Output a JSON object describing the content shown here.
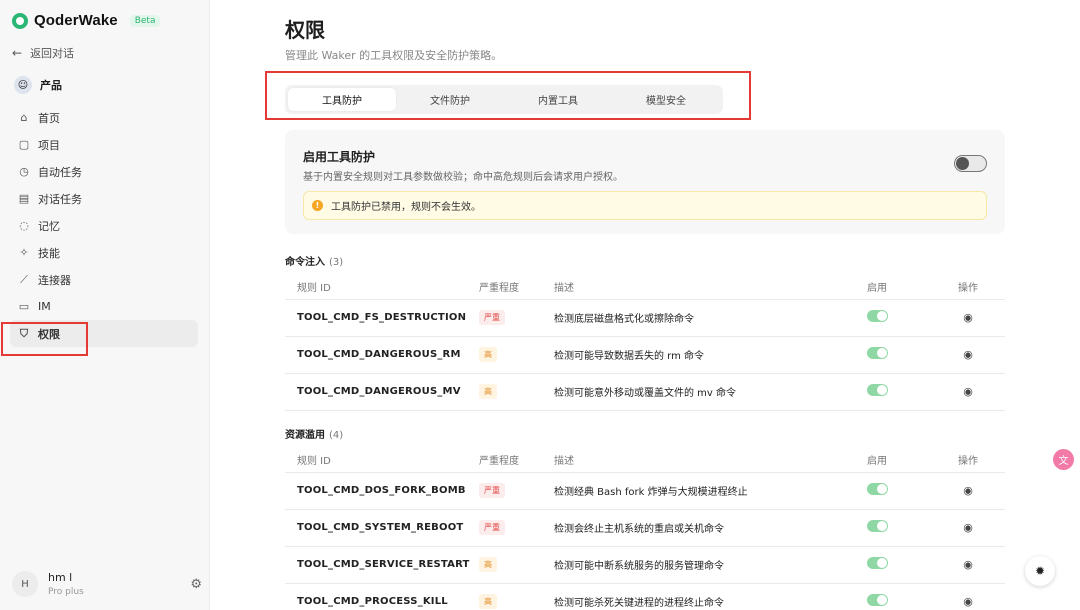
{
  "sidebar": {
    "brand": "QoderWake",
    "beta": "Beta",
    "back": "返回对话",
    "workspace": "产品",
    "items": [
      {
        "label": "首页",
        "icon": "home-icon",
        "glyph": "⌂"
      },
      {
        "label": "项目",
        "icon": "folder-icon",
        "glyph": "▢"
      },
      {
        "label": "自动任务",
        "icon": "clock-icon",
        "glyph": "◷"
      },
      {
        "label": "对话任务",
        "icon": "calendar-icon",
        "glyph": "▤"
      },
      {
        "label": "记忆",
        "icon": "memory-icon",
        "glyph": "◌"
      },
      {
        "label": "技能",
        "icon": "bolt-icon",
        "glyph": "✧"
      },
      {
        "label": "连接器",
        "icon": "plug-icon",
        "glyph": "⟋"
      },
      {
        "label": "IM",
        "icon": "message-icon",
        "glyph": "▭"
      },
      {
        "label": "权限",
        "icon": "shield-icon",
        "glyph": "⛉",
        "active": true
      }
    ],
    "user": {
      "initial": "H",
      "name": "hm l",
      "plan": "Pro plus"
    }
  },
  "page": {
    "title": "权限",
    "subtitle": "管理此 Waker 的工具权限及安全防护策略。",
    "tabs": [
      "工具防护",
      "文件防护",
      "内置工具",
      "模型安全"
    ],
    "active_tab": 0
  },
  "protection": {
    "title": "启用工具防护",
    "desc": "基于内置安全规则对工具参数做校验；命中高危规则后会请求用户授权。",
    "enabled": false,
    "warning": "工具防护已禁用，规则不会生效。"
  },
  "table_headers": {
    "id": "规则 ID",
    "severity": "严重程度",
    "desc": "描述",
    "enabled": "启用",
    "op": "操作"
  },
  "sections": [
    {
      "title": "命令注入",
      "count": "(3)",
      "rules": [
        {
          "id": "TOOL_CMD_FS_DESTRUCTION",
          "severity": "严重",
          "level": "crit",
          "desc": "检测底层磁盘格式化或擦除命令",
          "enabled": true
        },
        {
          "id": "TOOL_CMD_DANGEROUS_RM",
          "severity": "高",
          "level": "high",
          "desc": "检测可能导致数据丢失的 rm 命令",
          "enabled": true
        },
        {
          "id": "TOOL_CMD_DANGEROUS_MV",
          "severity": "高",
          "level": "high",
          "desc": "检测可能意外移动或覆盖文件的 mv 命令",
          "enabled": true
        }
      ]
    },
    {
      "title": "资源滥用",
      "count": "(4)",
      "rules": [
        {
          "id": "TOOL_CMD_DOS_FORK_BOMB",
          "severity": "严重",
          "level": "crit",
          "desc": "检测经典 Bash fork 炸弹与大规模进程终止",
          "enabled": true
        },
        {
          "id": "TOOL_CMD_SYSTEM_REBOOT",
          "severity": "严重",
          "level": "crit",
          "desc": "检测会终止主机系统的重启或关机命令",
          "enabled": true
        },
        {
          "id": "TOOL_CMD_SERVICE_RESTART",
          "severity": "高",
          "level": "high",
          "desc": "检测可能中断系统服务的服务管理命令",
          "enabled": true
        },
        {
          "id": "TOOL_CMD_PROCESS_KILL",
          "severity": "高",
          "level": "high",
          "desc": "检测可能杀死关键进程的进程终止命令",
          "enabled": true
        }
      ]
    }
  ],
  "colors": {
    "brand": "#2bb673",
    "critical": "#e04343",
    "high": "#e08a1e",
    "toggle_on": "#8fd8a6",
    "highlight_box": "#e53935"
  }
}
